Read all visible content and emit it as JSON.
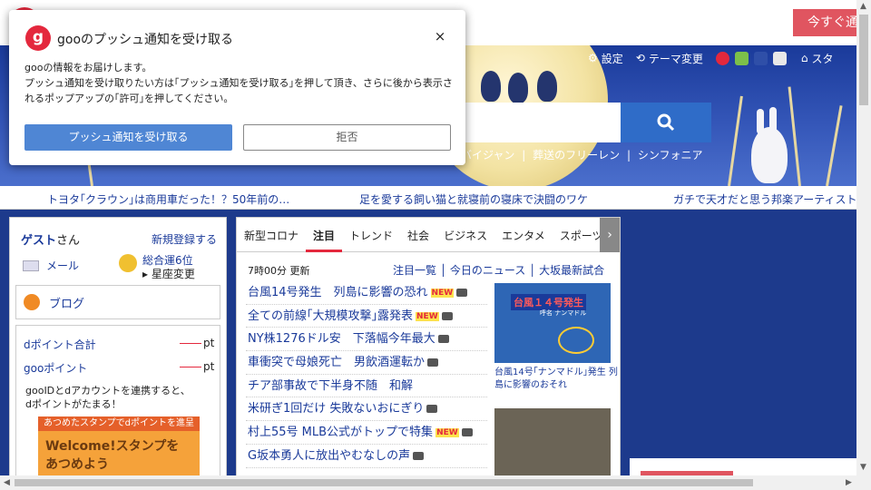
{
  "cta": {
    "label": "今すぐ通"
  },
  "header": {
    "settings_label": "設定",
    "theme_label": "テーマ変更",
    "start_label": "スタ"
  },
  "trends": [
    "バイジャン",
    "|",
    "葬送のフリーレン",
    "|",
    "シンフォニア"
  ],
  "ticker": [
    "トヨタ｢クラウン｣は商用車だった！？50年前の…",
    "足を愛する飼い猫と就寝前の寝床で決闘のワケ",
    "ガチで天才だと思う邦楽アーティストラ"
  ],
  "sidebar": {
    "guest": "ゲスト",
    "guest_suffix": "さん",
    "signup": "新規登録する",
    "mail": "メール",
    "fortune_rank": "総合運6位",
    "fortune_change": "▸ 星座変更",
    "blog": "ブログ",
    "dpoint_label": "dポイント合計",
    "goopoint_label": "gooポイント",
    "point_unit": "pt",
    "promo_line1": "gooIDとdアカウントを連携すると、",
    "promo_line2": "dポイントがたまる！",
    "promo_top": "あつめたスタンプでdポイントを進呈",
    "promo_title": "Welcome!スタンプを",
    "promo_title2": "あつめよう"
  },
  "news": {
    "tabs": [
      "新型コロナ",
      "注目",
      "トレンド",
      "社会",
      "ビジネス",
      "エンタメ",
      "スポーツ"
    ],
    "active_tab": "注目",
    "updated": "7時00分 更新",
    "sub_links": "注目一覧 │ 今日のニュース │ 大坂最新試合",
    "new_badge": "NEW",
    "headlines": [
      {
        "text": "台風14号発生　列島に影響の恐れ",
        "new": true
      },
      {
        "text": "全ての前線｢大規模攻撃｣露発表",
        "new": true
      },
      {
        "text": "NY株1276ドル安　下落幅今年最大",
        "new": false
      },
      {
        "text": "車衝突で母娘死亡　男飲酒運転か",
        "new": false
      },
      {
        "text": "チア部事故で下半身不随　和解",
        "new": false
      },
      {
        "text": "米研ぎ1回だけ 失敗ないおにぎり",
        "new": false
      },
      {
        "text": "村上55号 MLB公式がトップで特集",
        "new": true
      },
      {
        "text": "G坂本勇人に放出やむなしの声",
        "new": false
      }
    ],
    "photo1_title": "台風１４号発生",
    "photo1_name": "呼名 ナンマドル",
    "photo1_caption": "台風14号｢ナンマドル｣発生 列島に影響のおそれ"
  },
  "popup": {
    "title": "gooのプッシュ通知を受け取る",
    "close": "×",
    "line1": "gooの情報をお届けします。",
    "line2": "プッシュ通知を受け取りたい方は｢プッシュ通知を受け取る｣を押して頂き、さらに後から表示さ",
    "line3": "れるポップアップの｢許可｣を押してください。",
    "accept": "プッシュ通知を受け取る",
    "deny": "拒否",
    "logo_letter": "g"
  },
  "colors": {
    "brand_red": "#e4283d",
    "header_blue": "#1a3a9a",
    "accept_blue": "#4f86d4"
  }
}
